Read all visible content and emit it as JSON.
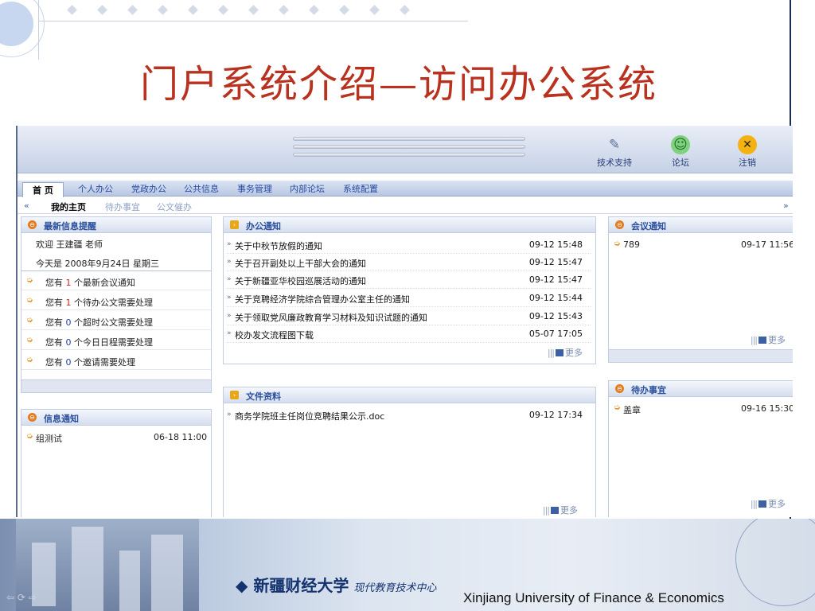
{
  "slide": {
    "title": "门户系统介绍—访问办公系统",
    "footer_cn": "新疆财经大学",
    "footer_cn_sub": "现代教育技术中心",
    "footer_en": "Xinjiang University of Finance & Economics"
  },
  "topbar": {
    "support_label": "技术支持",
    "forum_label": "论坛",
    "logout_label": "注销"
  },
  "menu": {
    "items": [
      "首 页",
      "个人办公",
      "党政办公",
      "公共信息",
      "事务管理",
      "内部论坛",
      "系统配置"
    ]
  },
  "submenu": {
    "prev": "«",
    "next": "»",
    "items": [
      "我的主页",
      "待办事宜",
      "公文催办"
    ]
  },
  "reminder": {
    "title": "最新信息提醒",
    "welcome": "欢迎 王建疆 老师",
    "date": "今天是 2008年9月24日 星期三",
    "rows": [
      {
        "pre": "您有",
        "count": "1",
        "post": "个最新会议通知"
      },
      {
        "pre": "您有",
        "count": "1",
        "post": "个待办公文需要处理"
      },
      {
        "pre": "您有",
        "count": "0",
        "post": "个超时公文需要处理"
      },
      {
        "pre": "您有",
        "count": "0",
        "post": "个今日日程需要处理"
      },
      {
        "pre": "您有",
        "count": "0",
        "post": "个邀请需要处理"
      }
    ]
  },
  "info_notice": {
    "title": "信息通知",
    "items": [
      {
        "title": "组测试",
        "time": "06-18 11:00"
      }
    ]
  },
  "office_notice": {
    "title": "办公通知",
    "more": "更多",
    "items": [
      {
        "title": "关于中秋节放假的通知",
        "time": "09-12 15:48"
      },
      {
        "title": "关于召开副处以上干部大会的通知",
        "time": "09-12 15:47"
      },
      {
        "title": "关于新疆亚华校园巡展活动的通知",
        "time": "09-12 15:47"
      },
      {
        "title": "关于竞聘经济学院综合管理办公室主任的通知",
        "time": "09-12 15:44"
      },
      {
        "title": "关于领取党风廉政教育学习材料及知识试题的通知",
        "time": "09-12 15:43"
      },
      {
        "title": "校办发文流程图下载",
        "time": "05-07 17:05"
      }
    ]
  },
  "files": {
    "title": "文件资料",
    "more": "更多",
    "items": [
      {
        "title": "商务学院班主任岗位竞聘结果公示.doc",
        "time": "09-12 17:34"
      }
    ]
  },
  "meeting": {
    "title": "会议通知",
    "more": "更多",
    "items": [
      {
        "title": "789",
        "time": "09-17 11:56"
      }
    ]
  },
  "todo": {
    "title": "待办事宜",
    "more": "更多",
    "items": [
      {
        "title": "盖章",
        "time": "09-16 15:30"
      }
    ]
  },
  "colors": {
    "title_red": "#b8321f",
    "link_blue": "#264ba0",
    "panel_head_text": "#2a4f9e",
    "count_red": "#d42020",
    "count_blue": "#2240a8"
  }
}
